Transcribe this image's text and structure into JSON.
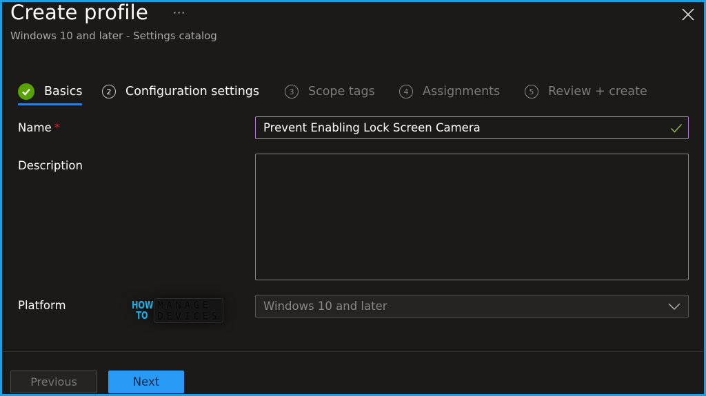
{
  "header": {
    "title": "Create profile",
    "more_label": "···",
    "subtitle": "Windows 10 and later - Settings catalog"
  },
  "wizard": {
    "steps": [
      {
        "number": "1",
        "label": "Basics",
        "state": "completed"
      },
      {
        "number": "2",
        "label": "Configuration settings",
        "state": "enabled"
      },
      {
        "number": "3",
        "label": "Scope tags",
        "state": "disabled"
      },
      {
        "number": "4",
        "label": "Assignments",
        "state": "disabled"
      },
      {
        "number": "5",
        "label": "Review + create",
        "state": "disabled"
      }
    ]
  },
  "form": {
    "name": {
      "label": "Name",
      "required_marker": "*",
      "value": "Prevent Enabling Lock Screen Camera",
      "valid": true
    },
    "description": {
      "label": "Description",
      "value": ""
    },
    "platform": {
      "label": "Platform",
      "value": "Windows 10 and later"
    }
  },
  "watermark": {
    "line1": "HOW",
    "line2": "TO",
    "brand_line1": "MANAGE",
    "brand_line2": "DEVICES"
  },
  "footer": {
    "previous_label": "Previous",
    "next_label": "Next"
  },
  "colors": {
    "accent": "#2899f5",
    "success": "#57a300",
    "frame": "#1ba1e2",
    "required": "#e81123"
  }
}
